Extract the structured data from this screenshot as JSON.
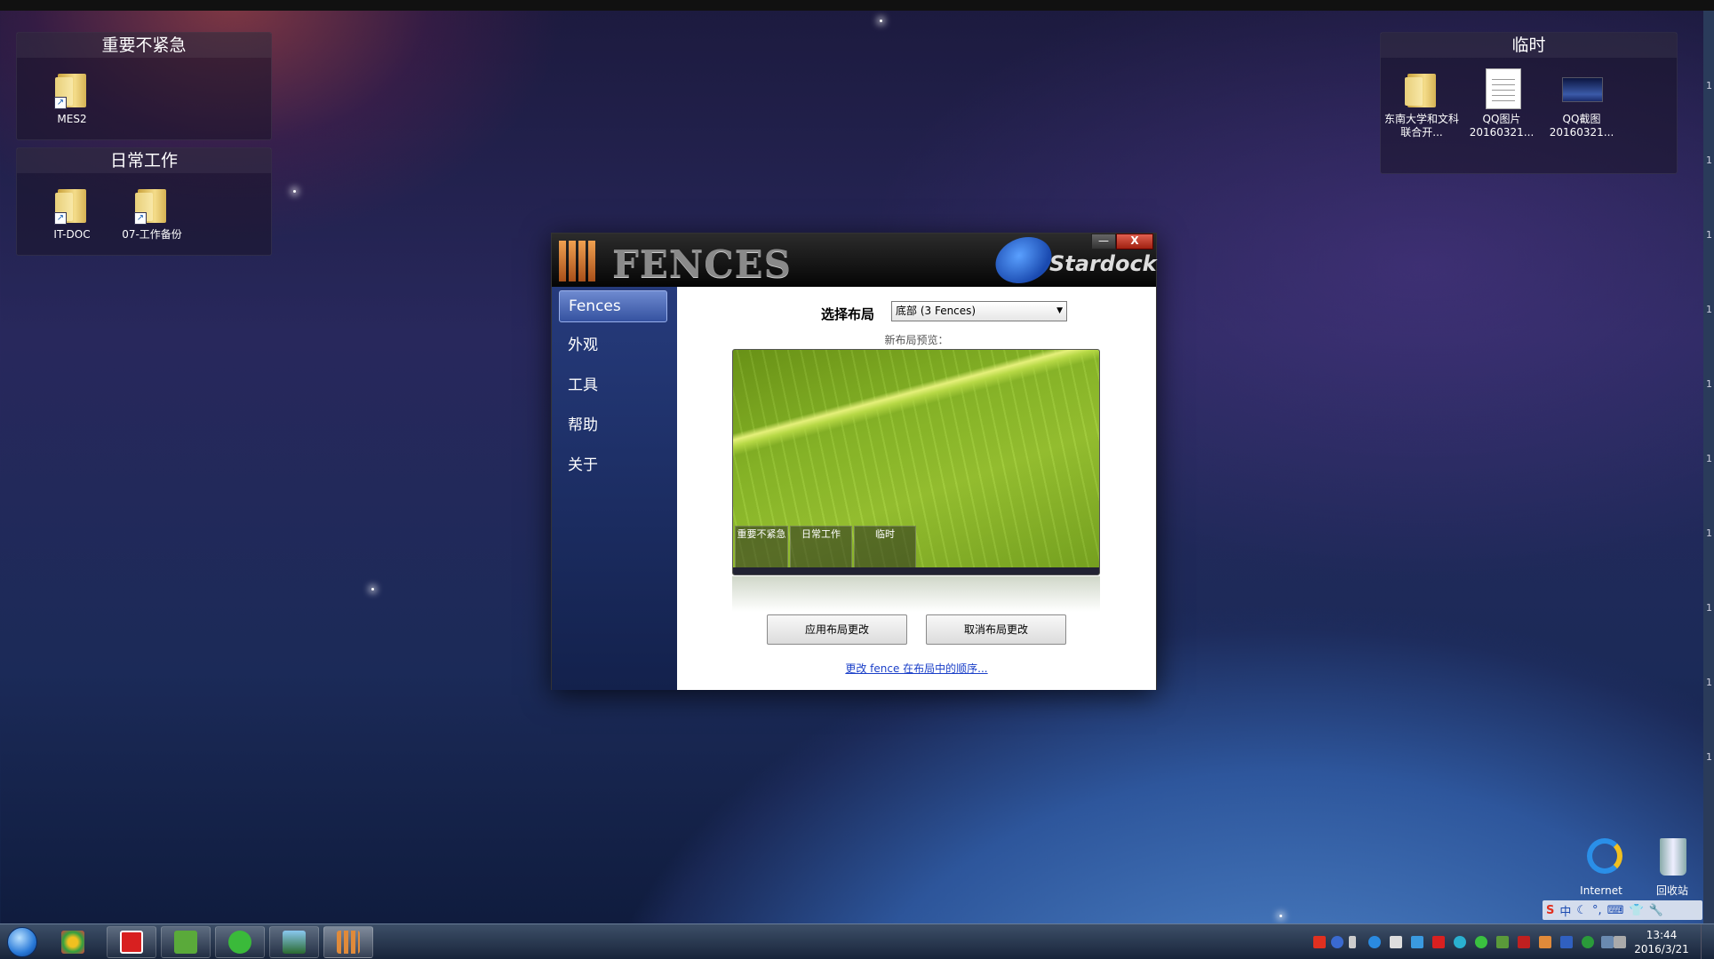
{
  "desktop": {
    "fences": [
      {
        "title": "重要不紧急",
        "icons": [
          {
            "label": "MES2"
          }
        ]
      },
      {
        "title": "日常工作",
        "icons": [
          {
            "label": "IT-DOC"
          },
          {
            "label": "07-工作备份"
          }
        ]
      },
      {
        "title": "临时",
        "icons": [
          {
            "label": "东南大学和文科联合开..."
          },
          {
            "label": "QQ图片20160321..."
          },
          {
            "label": "QQ截图20160321..."
          }
        ]
      }
    ],
    "bottom_icons": [
      {
        "label": "Internet"
      },
      {
        "label": "回收站"
      }
    ],
    "edge_digits": [
      "1",
      "1",
      "1",
      "1",
      "1",
      "1",
      "1",
      "1",
      "1",
      "1"
    ]
  },
  "window": {
    "app_name": "Fences",
    "logo_text": "FENCES",
    "vendor": "Stardock",
    "minimize_glyph": "—",
    "close_glyph": "X",
    "nav": [
      {
        "label": "Fences",
        "active": true
      },
      {
        "label": "外观"
      },
      {
        "label": "工具"
      },
      {
        "label": "帮助"
      },
      {
        "label": "关于"
      }
    ],
    "select_label": "选择布局",
    "select_value": "底部 (3 Fences)",
    "preview_label": "新布局预览：",
    "preview_fences": [
      "重要不紧急",
      "日常工作",
      "临时"
    ],
    "apply_button": "应用布局更改",
    "cancel_button": "取消布局更改",
    "order_link": "更改 fence 在布局中的顺序..."
  },
  "ime": {
    "items": [
      "S",
      "中",
      "☾",
      "°,",
      "⌨",
      "👕",
      "🔧"
    ]
  },
  "taskbar": {
    "clock_time": "13:44",
    "clock_date": "2016/3/21"
  },
  "colors": {
    "accent": "#2a5ab8",
    "close": "#c03020",
    "link": "#1a3fc8"
  }
}
